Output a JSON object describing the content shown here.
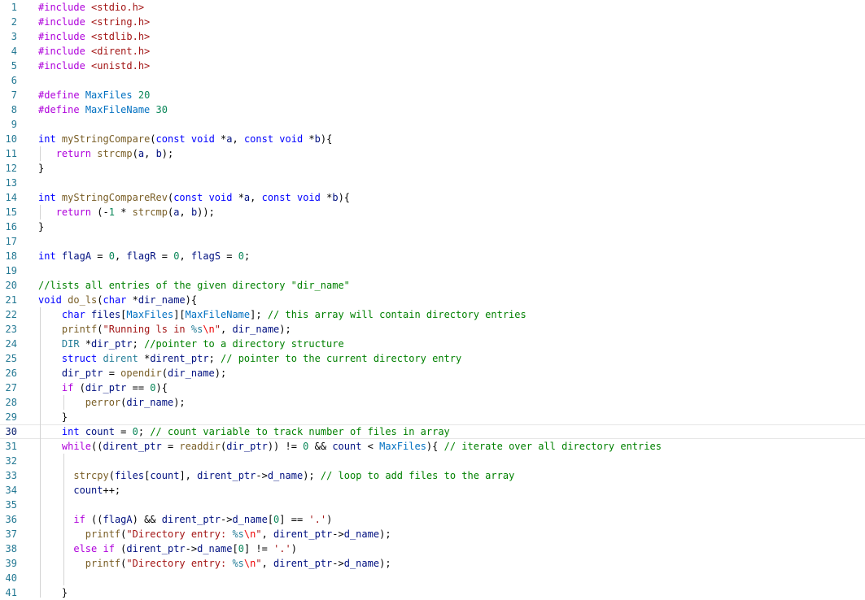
{
  "editor": {
    "active_line": 30,
    "lines": [
      {
        "n": "1",
        "code": "#include <stdio.h>"
      },
      {
        "n": "2",
        "code": "#include <string.h>"
      },
      {
        "n": "3",
        "code": "#include <stdlib.h>"
      },
      {
        "n": "4",
        "code": "#include <dirent.h>"
      },
      {
        "n": "5",
        "code": "#include <unistd.h>"
      },
      {
        "n": "6",
        "code": ""
      },
      {
        "n": "7",
        "code": "#define MaxFiles 20"
      },
      {
        "n": "8",
        "code": "#define MaxFileName 30"
      },
      {
        "n": "9",
        "code": ""
      },
      {
        "n": "10",
        "code": "int myStringCompare(const void *a, const void *b){"
      },
      {
        "n": "11",
        "code": "   return strcmp(a, b);"
      },
      {
        "n": "12",
        "code": "}"
      },
      {
        "n": "13",
        "code": ""
      },
      {
        "n": "14",
        "code": "int myStringCompareRev(const void *a, const void *b){"
      },
      {
        "n": "15",
        "code": "   return (-1 * strcmp(a, b));"
      },
      {
        "n": "16",
        "code": "}"
      },
      {
        "n": "17",
        "code": ""
      },
      {
        "n": "18",
        "code": "int flagA = 0, flagR = 0, flagS = 0;"
      },
      {
        "n": "19",
        "code": ""
      },
      {
        "n": "20",
        "code": "//lists all entries of the given directory \"dir_name\""
      },
      {
        "n": "21",
        "code": "void do_ls(char *dir_name){"
      },
      {
        "n": "22",
        "code": "    char files[MaxFiles][MaxFileName]; // this array will contain directory entries"
      },
      {
        "n": "23",
        "code": "    printf(\"Running ls in %s\\n\", dir_name);"
      },
      {
        "n": "24",
        "code": "    DIR *dir_ptr; //pointer to a directory structure"
      },
      {
        "n": "25",
        "code": "    struct dirent *dirent_ptr; // pointer to the current directory entry"
      },
      {
        "n": "26",
        "code": "    dir_ptr = opendir(dir_name);"
      },
      {
        "n": "27",
        "code": "    if (dir_ptr == 0){"
      },
      {
        "n": "28",
        "code": "        perror(dir_name);"
      },
      {
        "n": "29",
        "code": "    }"
      },
      {
        "n": "30",
        "code": "    int count = 0; // count variable to track number of files in array"
      },
      {
        "n": "31",
        "code": "    while((dirent_ptr = readdir(dir_ptr)) != 0 && count < MaxFiles){ // iterate over all directory entries"
      },
      {
        "n": "32",
        "code": ""
      },
      {
        "n": "33",
        "code": "      strcpy(files[count], dirent_ptr->d_name); // loop to add files to the array"
      },
      {
        "n": "34",
        "code": "      count++;"
      },
      {
        "n": "35",
        "code": ""
      },
      {
        "n": "36",
        "code": "      if ((flagA) && dirent_ptr->d_name[0] == '.')"
      },
      {
        "n": "37",
        "code": "        printf(\"Directory entry: %s\\n\", dirent_ptr->d_name);"
      },
      {
        "n": "38",
        "code": "      else if (dirent_ptr->d_name[0] != '.')"
      },
      {
        "n": "39",
        "code": "        printf(\"Directory entry: %s\\n\", dirent_ptr->d_name);"
      },
      {
        "n": "40",
        "code": ""
      },
      {
        "n": "41",
        "code": "    }"
      }
    ]
  },
  "colors": {
    "background": "#ffffff",
    "line_number": "#237893",
    "keyword": "#0000ff",
    "preprocessor": "#af00db",
    "string": "#a31515",
    "number": "#098658",
    "comment": "#008000",
    "function": "#795e26",
    "variable": "#001080"
  }
}
